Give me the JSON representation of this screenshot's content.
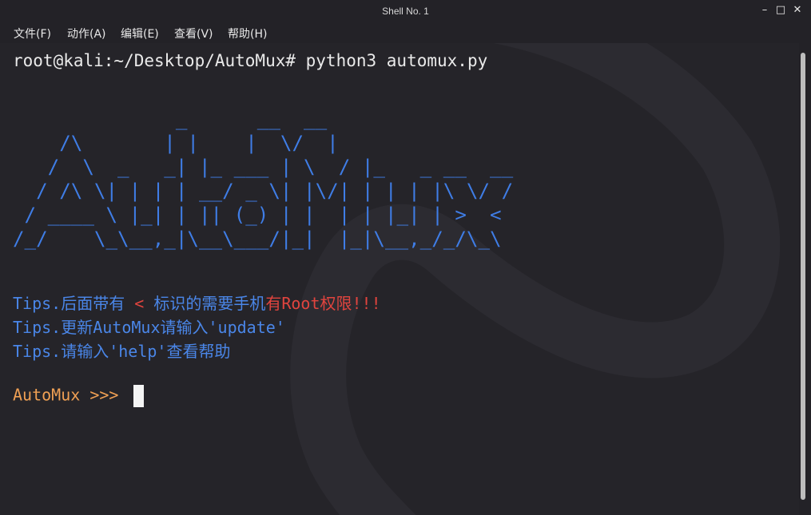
{
  "window": {
    "title": "Shell No. 1"
  },
  "menu": {
    "items": [
      "文件(F)",
      "动作(A)",
      "编辑(E)",
      "查看(V)",
      "帮助(H)"
    ]
  },
  "terminal": {
    "command_prompt": "root@kali:~/Desktop/AutoMux# python3 automux.py",
    "ascii_banner": "              _      __  __\n    /\\       | |    |  \\/  |\n   /  \\  _   _| |_ ___ | \\  / |_   _ __  __\n  / /\\ \\| | | | __/ _ \\| |\\/| | | | |\\ \\/ /\n / ____ \\ |_| | || (_) | |  | | |_| | >  <\n/_/    \\_\\__,_|\\__\\___/|_|  |_|\\__,_/_/\\_\\",
    "tip1": {
      "prefix": "Tips.后面带有 ",
      "marker": "< ",
      "middle": "标识的需要手机",
      "suffix": "有Root权限!!!"
    },
    "tip2": "Tips.更新AutoMux请输入'update'",
    "tip3": "Tips.请输入'help'查看帮助",
    "input_prompt": "AutoMux >>> "
  }
}
